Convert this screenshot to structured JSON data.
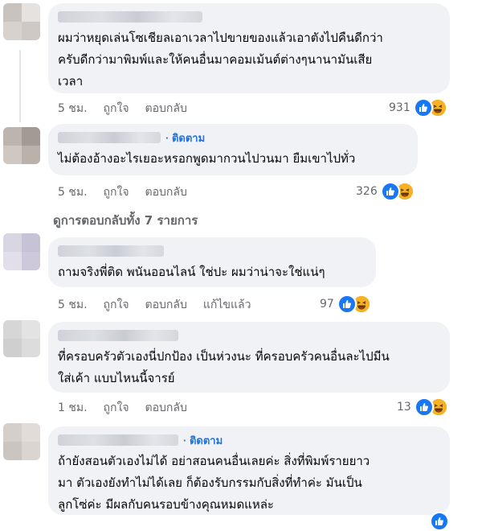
{
  "comments": [
    {
      "id": "c1",
      "text": "ผมว่าหยุดเล่นโซเชียลเอาเวลาไปขายของแล้วเอาตังไปคืนดีกว่า\nครับดีกว่ามาพิมพ์และให้คนอื่นมาคอมเม้นต์ต่างๆนานามันเสีย\nเวลา",
      "time": "5 ชม.",
      "like": "ถูกใจ",
      "reply": "ตอบกลับ",
      "reactions": "931"
    },
    {
      "id": "c2",
      "follow": "· ติดตาม",
      "text": "ไม่ต้องอ้างอะไรเยอะหรอกพูดมากวนไปวนมา ยืมเขาไปทั่ว",
      "time": "5 ชม.",
      "like": "ถูกใจ",
      "reply": "ตอบกลับ",
      "reactions": "326"
    },
    {
      "id": "c3",
      "text": "ถามจริงพี่ติด พนันออนไลน์ ใช่ปะ ผมว่าน่าจะใช่แน่ๆ",
      "time": "5 ชม.",
      "like": "ถูกใจ",
      "reply": "ตอบกลับ",
      "edited": "แก้ไขแล้ว",
      "reactions": "97"
    },
    {
      "id": "c4",
      "text": "ที่ครอบครัวตัวเองนี่ปกป้อง เป็นห่วงนะ ที่ครอบครัวคนอื่นละไปมีน\nใส่เค้า แบบไหนนี้จารย์",
      "time": "1 ชม.",
      "like": "ถูกใจ",
      "reply": "ตอบกลับ",
      "reactions": "13"
    },
    {
      "id": "c5",
      "follow": "· ติดตาม",
      "text": "ถ้ายังสอนตัวเองไม่ได้ อย่าสอนคนอื่นเลยค่ะ สิ่งที่พิมพ์รายยาว\nมา ตัวเองยังทำไม่ได้เลย ก็ต้องรับกรรมกับสิ่งที่ทำค่ะ มันเป็น\nลูกโซ่ค่ะ มีผลกับคนรอบข้างคุณหมดแหล่ะ"
    }
  ],
  "view_replies": "ดูการตอบกลับทั้ง 7 รายการ",
  "colors": {
    "like": "#1877f2",
    "haha": "#f7b125",
    "bubble": "#f0f2f5",
    "link": "#1b74e4",
    "meta": "#65676b"
  }
}
